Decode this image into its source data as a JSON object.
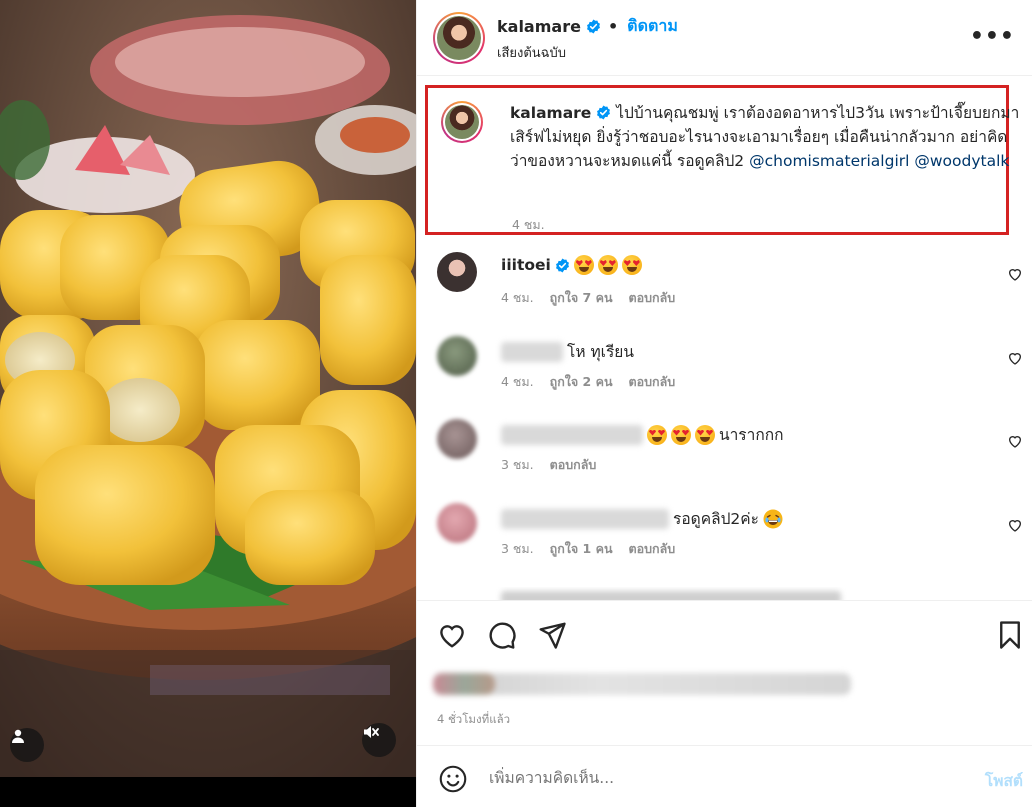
{
  "post": {
    "username": "kalamare",
    "verified": true,
    "follow_label": "ติดตาม",
    "audio_label": "เสียงต้นฉบับ",
    "more_label": "•••"
  },
  "caption": {
    "username": "kalamare",
    "text": "ไปบ้านคุณชมพู่ เราต้องอดอาหารไป3วัน เพราะป้าเจี๊ยบยกมาเสิร์ฟไม่หยุด ยิ่งรู้ว่าชอบอะไรนางจะเอามาเรื่อยๆ เมื่อคืนน่ากลัวมาก อย่าคิดว่าของหวานจะหมดแค่นี้ รอดูคลิป2",
    "mention1": "@chomismaterialgirl",
    "mention2": "@woodytalk",
    "time": "4 ชม."
  },
  "comments": [
    {
      "username": "iiitoei",
      "verified": true,
      "text": "",
      "emoji_count": 3,
      "time": "4 ชม.",
      "likes": "ถูกใจ 7 คน",
      "reply": "ตอบกลับ",
      "avatar_color": "#3b3130"
    },
    {
      "username": "",
      "text": "โห ทุเรียน",
      "emoji_count": 0,
      "time": "4 ชม.",
      "likes": "ถูกใจ 2 คน",
      "reply": "ตอบกลับ",
      "avatar_color": "#6b7a63"
    },
    {
      "username": "",
      "text": "นารากกก",
      "emoji_count": 3,
      "time": "3 ชม.",
      "likes": "",
      "reply": "ตอบกลับ",
      "avatar_color": "#8c7b7b"
    },
    {
      "username": "",
      "text": "รอดูคลิป2ค่ะ",
      "emoji_count": 0,
      "time": "3 ชม.",
      "likes": "ถูกใจ 1 คน",
      "reply": "ตอบกลับ",
      "avatar_color": "#c9868e"
    }
  ],
  "footer": {
    "time_ago": "4 ชั่วโมงที่แล้ว",
    "comment_placeholder": "เพิ่มความคิดเห็น...",
    "post_label": "โพสต์"
  },
  "colors": {
    "accent": "#0095f6",
    "caption_border": "#d42222",
    "muted": "#8e8e8e"
  }
}
